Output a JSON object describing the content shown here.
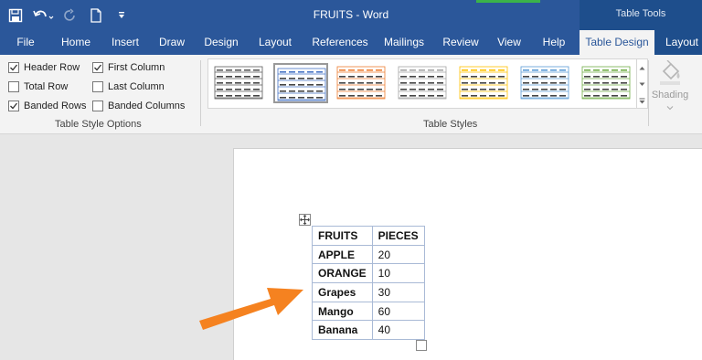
{
  "window": {
    "title": "FRUITS  -  Word",
    "context_group": "Table Tools"
  },
  "quick_access": {
    "icons": [
      "save-icon",
      "undo-icon",
      "redo-icon",
      "new-document-icon",
      "customize-qat-icon"
    ]
  },
  "tabs": [
    {
      "label": "File"
    },
    {
      "label": "Home"
    },
    {
      "label": "Insert"
    },
    {
      "label": "Draw"
    },
    {
      "label": "Design"
    },
    {
      "label": "Layout"
    },
    {
      "label": "References"
    },
    {
      "label": "Mailings"
    },
    {
      "label": "Review"
    },
    {
      "label": "View"
    },
    {
      "label": "Help"
    },
    {
      "label": "Table Design",
      "active": true
    },
    {
      "label": "Layout"
    }
  ],
  "table_style_options": {
    "group_label": "Table Style Options",
    "options": [
      {
        "label": "Header Row",
        "checked": true
      },
      {
        "label": "Total Row",
        "checked": false
      },
      {
        "label": "Banded Rows",
        "checked": true
      },
      {
        "label": "First Column",
        "checked": true
      },
      {
        "label": "Last Column",
        "checked": false
      },
      {
        "label": "Banded Columns",
        "checked": false
      }
    ]
  },
  "table_styles": {
    "group_label": "Table Styles",
    "swatch_colors": [
      "#5a5a5a",
      "#4472c4",
      "#ed7d31",
      "#a5a5a5",
      "#ffc000",
      "#5b9bd5",
      "#70ad47"
    ],
    "selected_index": 1
  },
  "shading": {
    "label": "Shading"
  },
  "document_table": {
    "headers": [
      "FRUITS",
      "PIECES"
    ],
    "rows": [
      [
        "APPLE",
        "20"
      ],
      [
        "ORANGE",
        "10"
      ],
      [
        "Grapes",
        "30"
      ],
      [
        "Mango",
        "60"
      ],
      [
        "Banana",
        "40"
      ]
    ]
  },
  "colors": {
    "ribbon_blue": "#2b579a",
    "context_blue": "#1e4e8c",
    "arrow_orange": "#f58220"
  }
}
